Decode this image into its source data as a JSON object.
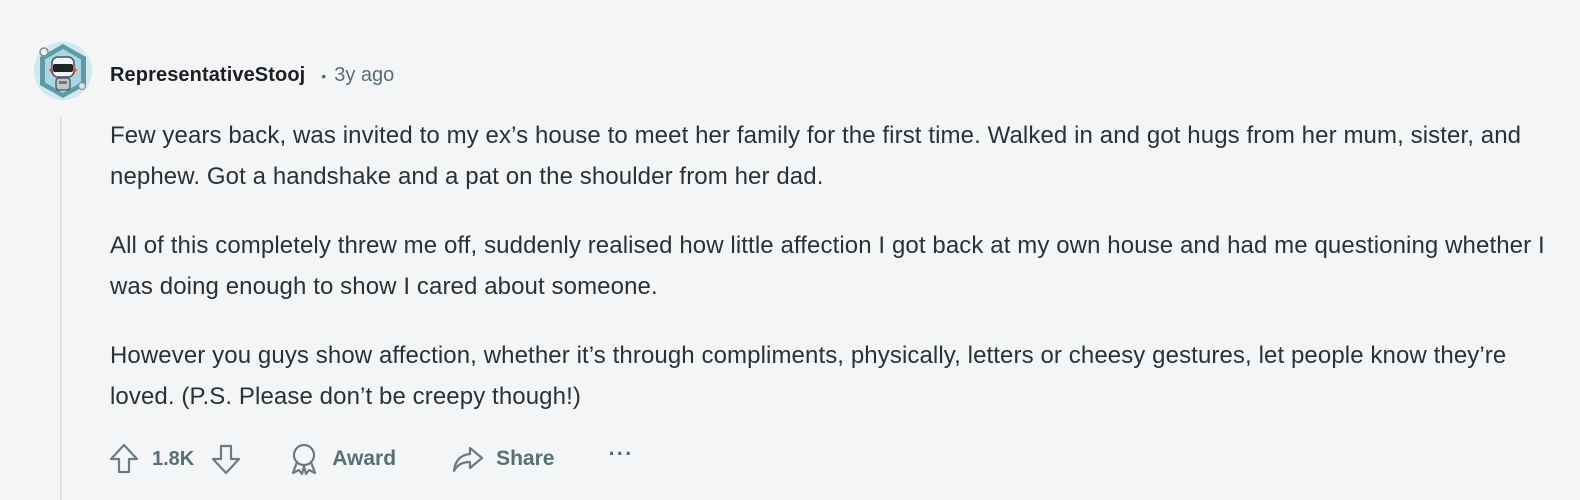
{
  "comment": {
    "author": "RepresentativeStooj",
    "separator": "•",
    "age": "3y ago",
    "avatar_icon": "robot-avatar-icon",
    "paragraphs": [
      "Few years back, was invited to my ex’s house to meet her family for the first time. Walked in and got hugs from her mum, sister, and nephew. Got a handshake and a pat on the shoulder from her dad.",
      "All of this completely threw me off, suddenly realised how little affection I got back at my own house and had me questioning whether I was doing enough to show I cared about someone.",
      "However you guys show affection, whether it’s through compliments, physically, letters or cheesy gestures, let people know they’re loved. (P.S. Please don’t be creepy though!)"
    ]
  },
  "actions": {
    "upvote_icon": "upvote-arrow-icon",
    "vote_count": "1.8K",
    "downvote_icon": "downvote-arrow-icon",
    "award_icon": "award-icon",
    "award_label": "Award",
    "share_icon": "share-arrow-icon",
    "share_label": "Share",
    "more_label": "···"
  },
  "colors": {
    "background": "#f4f5f7",
    "text": "#2a3236",
    "meta": "#576f76",
    "thread_line": "#dde3e7"
  }
}
